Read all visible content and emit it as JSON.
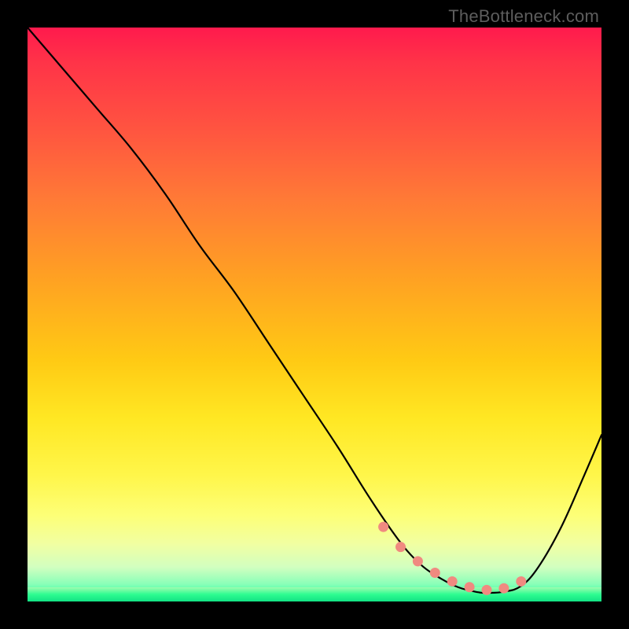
{
  "attribution": "TheBottleneck.com",
  "chart_data": {
    "type": "line",
    "title": "",
    "xlabel": "",
    "ylabel": "",
    "xlim": [
      0,
      100
    ],
    "ylim": [
      0,
      100
    ],
    "grid": false,
    "legend": false,
    "series": [
      {
        "name": "bottleneck-curve",
        "x": [
          0,
          6,
          12,
          18,
          24,
          30,
          36,
          42,
          48,
          54,
          59,
          63,
          66,
          69,
          72,
          75,
          78,
          80,
          83,
          86,
          89,
          93,
          97,
          100
        ],
        "values": [
          100,
          93,
          86,
          79,
          71,
          62,
          54,
          45,
          36,
          27,
          19,
          13,
          9,
          6,
          4,
          2.5,
          1.7,
          1.5,
          1.7,
          2.7,
          6,
          13,
          22,
          29
        ]
      }
    ],
    "markers": {
      "x": [
        62,
        65,
        68,
        71,
        74,
        77,
        80,
        83,
        86
      ],
      "values": [
        13,
        9.5,
        7,
        5,
        3.5,
        2.5,
        2.0,
        2.3,
        3.5
      ],
      "color": "#f08a80"
    },
    "gradient_bands": [
      {
        "stop": 0.0,
        "color": "#ff1a4d"
      },
      {
        "stop": 0.44,
        "color": "#ffa222"
      },
      {
        "stop": 0.78,
        "color": "#fff64a"
      },
      {
        "stop": 0.97,
        "color": "#88ffb8"
      },
      {
        "stop": 1.0,
        "color": "#17f08d"
      }
    ]
  }
}
